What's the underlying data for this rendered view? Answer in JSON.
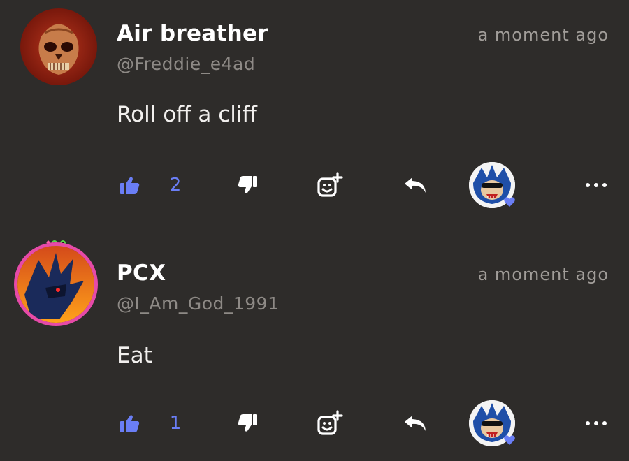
{
  "comments": [
    {
      "name": "Air breather",
      "handle": "@Freddie_e4ad",
      "time": "a moment ago",
      "text": "Roll off a cliff",
      "likes": "2",
      "avatar_icon": "skull-avatar"
    },
    {
      "name": "PCX",
      "handle": "@I_Am_God_1991",
      "time": "a moment ago",
      "text": "Eat",
      "likes": "1",
      "avatar_icon": "hedgehog-avatar"
    }
  ],
  "colors": {
    "background": "#2e2c2a",
    "accent": "#6a7ef5",
    "name": "#ffffff",
    "muted": "#8e8a86",
    "icon": "#ffffff",
    "frame": "#e64aa8"
  }
}
